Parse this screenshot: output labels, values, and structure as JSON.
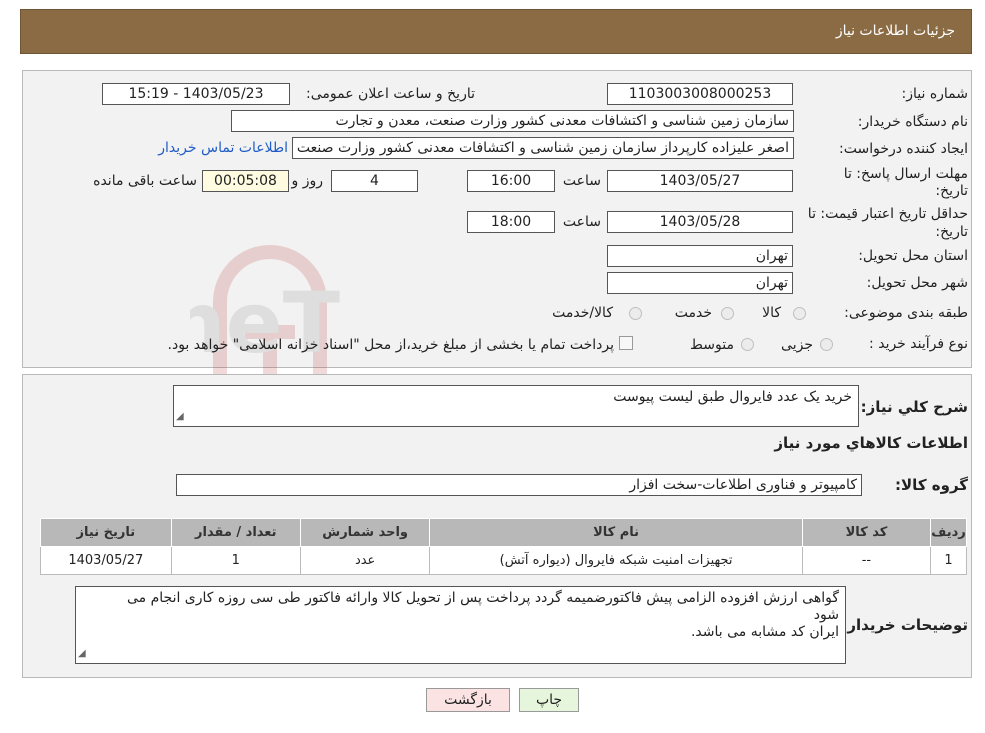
{
  "header": {
    "title": "جزئیات اطلاعات نیاز"
  },
  "form": {
    "need_number_label": "شماره نیاز:",
    "need_number": "1103003008000253",
    "announce_label": "تاریخ و ساعت اعلان عمومی:",
    "announce_value": "1403/05/23 - 15:19",
    "buyer_org_label": "نام دستگاه خریدار:",
    "buyer_org": "سازمان زمین شناسی و اکتشافات معدنی کشور وزارت صنعت، معدن و تجارت",
    "creator_label": "ایجاد کننده درخواست:",
    "creator": "اصغر علیزاده کارپرداز سازمان زمین شناسی و اکتشافات معدنی کشور وزارت صنعت",
    "contact_link": "اطلاعات تماس خریدار",
    "deadline_label_1": "مهلت ارسال پاسخ: تا",
    "deadline_label_2": "تاریخ:",
    "deadline_date": "1403/05/27",
    "time_label": "ساعت",
    "deadline_time": "16:00",
    "days_value": "4",
    "days_label": "روز و",
    "remaining_value": "00:05:08",
    "remaining_label": "ساعت باقی مانده",
    "validity_label_1": "حداقل تاریخ اعتبار قیمت: تا",
    "validity_label_2": "تاریخ:",
    "validity_date": "1403/05/28",
    "validity_time_label": "ساعت",
    "validity_time": "18:00",
    "province_label": "استان محل تحویل:",
    "province": "تهران",
    "city_label": "شهر محل تحویل:",
    "city": "تهران",
    "category_label": "طبقه بندی موضوعی:",
    "category_options": [
      "کالا",
      "خدمت",
      "کالا/خدمت"
    ],
    "process_label": "نوع فرآیند خرید :",
    "process_options": [
      "جزیی",
      "متوسط"
    ],
    "payment_note": "پرداخت تمام یا بخشی از مبلغ خرید،از محل \"اسناد خزانه اسلامی\" خواهد بود."
  },
  "details": {
    "summary_label": "شرح کلي نیاز:",
    "summary": "خرید یک عدد فایروال طبق لیست پیوست",
    "goods_info_title": "اطلاعات کالاهاي مورد نیاز",
    "goods_group_label": "گروه کالا:",
    "goods_group": "کامپیوتر و فناوری اطلاعات-سخت افزار",
    "table": {
      "headers": [
        "ردیف",
        "کد کالا",
        "نام کالا",
        "واحد شمارش",
        "تعداد / مقدار",
        "تاریخ نیاز"
      ],
      "rows": [
        [
          "1",
          "--",
          "تجهیزات امنیت شبکه فایروال (دیواره آتش)",
          "عدد",
          "1",
          "1403/05/27"
        ]
      ]
    },
    "buyer_notes_label": "توضیحات خریدار:",
    "buyer_notes_line1": "گواهی ارزش افزوده الزامی پیش فاکتورضمیمه گردد پرداخت پس از تحویل کالا وارائه فاکتور طی سی روزه کاری انجام می",
    "buyer_notes_line2": "شود",
    "buyer_notes_line3": "ایران کد مشابه می باشد."
  },
  "buttons": {
    "print": "چاپ",
    "back": "بازگشت"
  },
  "watermark": {
    "text": "AriaTender.neT"
  },
  "colors": {
    "header_bg": "#8b6b43",
    "link": "#1f5cc7",
    "back_btn_bg": "#fbe3e3",
    "print_btn_bg": "#e6f6dc"
  }
}
